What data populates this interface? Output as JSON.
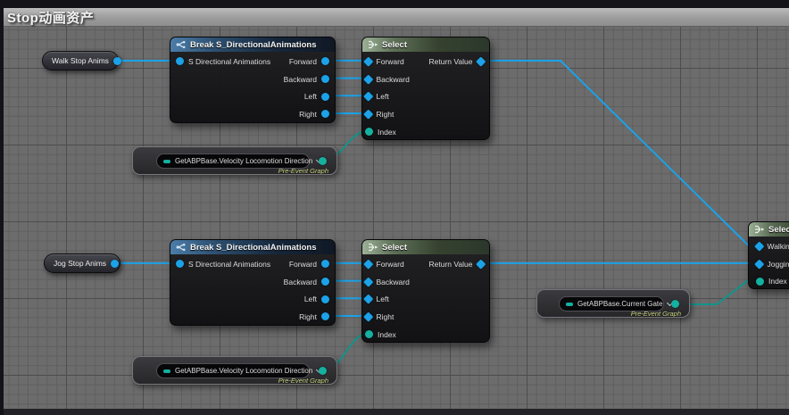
{
  "window": {
    "title": "Stop动画资产"
  },
  "colors": {
    "pin_blue": "#1ba2e8",
    "pin_teal": "#14b0a0",
    "wire_blue": "#1ba2e8",
    "wire_teal": "#11948a",
    "break_header": "#4b7da8",
    "select_header": "#9cb097",
    "graph_tag_text": "#cfd884"
  },
  "nodes": {
    "walk_var": {
      "label": "Walk Stop Anims"
    },
    "jog_var": {
      "label": "Jog Stop Anims"
    },
    "break_top": {
      "title": "Break S_DirectionalAnimations",
      "input_label": "S Directional Animations",
      "outputs": [
        "Forward",
        "Backward",
        "Left",
        "Right"
      ]
    },
    "break_bottom": {
      "title": "Break S_DirectionalAnimations",
      "input_label": "S Directional Animations",
      "outputs": [
        "Forward",
        "Backward",
        "Left",
        "Right"
      ]
    },
    "select_top": {
      "title": "Select",
      "inputs": [
        "Forward",
        "Backward",
        "Left",
        "Right",
        "Index"
      ],
      "output_label": "Return Value"
    },
    "select_bottom": {
      "title": "Select",
      "inputs": [
        "Forward",
        "Backward",
        "Left",
        "Right",
        "Index"
      ],
      "output_label": "Return Value"
    },
    "select_right": {
      "title": "Select",
      "inputs": [
        "Walking",
        "Jogging",
        "Index"
      ]
    },
    "prop_velocity_top": {
      "label": "GetABPBase.Velocity Locomotion Direction",
      "graph_label": "Pre-Event Graph"
    },
    "prop_velocity_bottom": {
      "label": "GetABPBase.Velocity Locomotion Direction",
      "graph_label": "Pre-Event Graph"
    },
    "prop_current_gate": {
      "label": "GetABPBase.Current Gate",
      "graph_label": "Pre-Event Graph"
    }
  }
}
